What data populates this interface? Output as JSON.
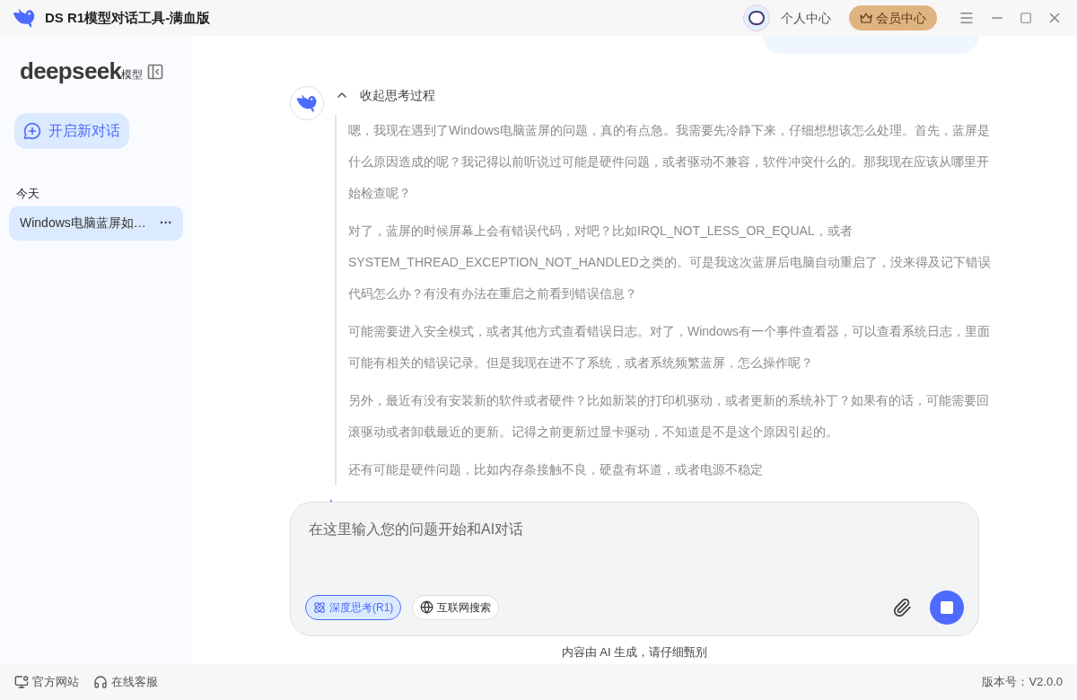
{
  "window": {
    "title": "DS R1模型对话工具-满血版"
  },
  "header": {
    "profile": "个人中心",
    "vip": "会员中心"
  },
  "sidebar": {
    "logo": "deepseek",
    "logo_suffix": "模型",
    "new_chat": "开启新对话",
    "section": "今天",
    "items": [
      {
        "label": "Windows电脑蓝屏如…",
        "more": "···",
        "selected": true
      }
    ]
  },
  "thinking": {
    "toggle": "收起思考过程",
    "expanded": true,
    "paragraphs": [
      "嗯，我现在遇到了Windows电脑蓝屏的问题，真的有点急。我需要先冷静下来，仔细想想该怎么处理。首先，蓝屏是什么原因造成的呢？我记得以前听说过可能是硬件问题，或者驱动不兼容，软件冲突什么的。那我现在应该从哪里开始检查呢？",
      "对了，蓝屏的时候屏幕上会有错误代码，对吧？比如IRQL_NOT_LESS_OR_EQUAL，或者SYSTEM_THREAD_EXCEPTION_NOT_HANDLED之类的。可是我这次蓝屏后电脑自动重启了，没来得及记下错误代码怎么办？有没有办法在重启之前看到错误信息？",
      "可能需要进入安全模式，或者其他方式查看错误日志。对了，Windows有一个事件查看器，可以查看系统日志，里面可能有相关的错误记录。但是我现在进不了系统，或者系统频繁蓝屏，怎么操作呢？",
      "另外，最近有没有安装新的软件或者硬件？比如新装的打印机驱动，或者更新的系统补丁？如果有的话，可能需要回滚驱动或者卸载最近的更新。记得之前更新过显卡驱动，不知道是不是这个原因引起的。",
      "还有可能是硬件问题，比如内存条接触不良，硬盘有坏道，或者电源不稳定"
    ]
  },
  "input": {
    "placeholder": "在这里输入您的问题开始和AI对话",
    "options": [
      {
        "label": "深度思考(R1)",
        "kind": "think",
        "selected": true
      },
      {
        "label": "互联网搜索",
        "kind": "web",
        "selected": false
      }
    ]
  },
  "disclaimer": "内容由 AI 生成，请仔细甄别",
  "footer": {
    "links": [
      {
        "label": "官方网站",
        "kind": "site"
      },
      {
        "label": "在线客服",
        "kind": "support"
      }
    ],
    "version": "版本号：V2.0.0"
  }
}
